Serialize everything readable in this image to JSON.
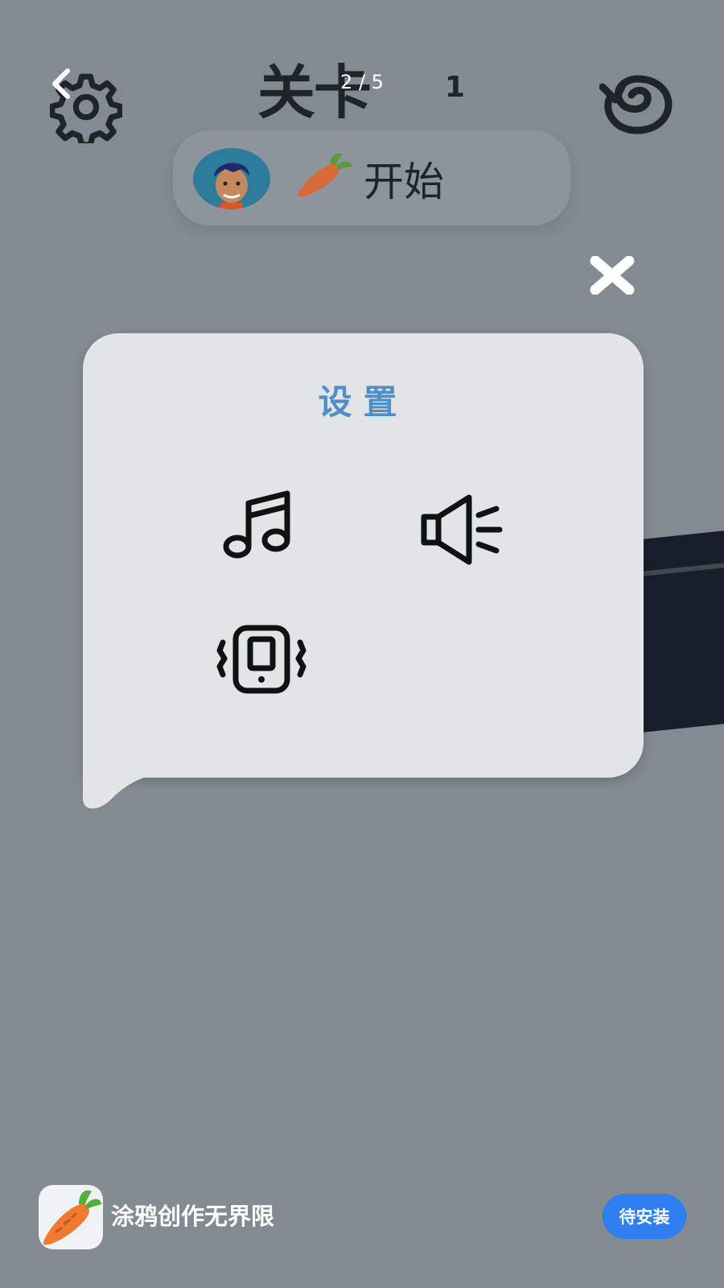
{
  "hud": {
    "level_title": "关卡",
    "level_number": "1",
    "page_indicator": "2 / 5",
    "start_label": "开始"
  },
  "dialog": {
    "title": "设置"
  },
  "ad": {
    "text": "涂鸦创作无界限",
    "install_label": "待安装"
  },
  "icons": [
    "back-icon",
    "settings-icon",
    "replay-icon",
    "avatar",
    "carrot-icon",
    "close-icon",
    "music-icon",
    "sound-icon",
    "vibrate-icon"
  ],
  "colors": {
    "background": "#838a91",
    "dialog": "#e3e4e6",
    "title_accent": "#4f8fc6",
    "install_button": "#2f7ff0"
  }
}
